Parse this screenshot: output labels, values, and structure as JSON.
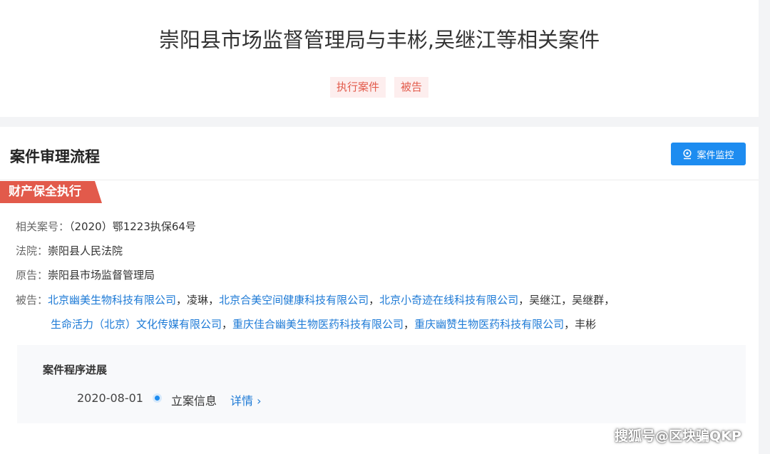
{
  "header": {
    "title": "崇阳县市场监督管理局与丰彬,吴继江等相关案件",
    "tags": [
      "执行案件",
      "被告"
    ]
  },
  "section": {
    "title": "案件审理流程",
    "monitor_label": "案件监控",
    "monitor_icon": "location-pin-icon",
    "stage": "财产保全执行"
  },
  "info": {
    "case_no_label": "相关案号：",
    "case_no": "（2020）鄂1223执保64号",
    "court_label": "法院：",
    "court": "崇阳县人民法院",
    "plaintiff_label": "原告：",
    "plaintiff": "崇阳县市场监督管理局",
    "defendant_label": "被告：",
    "defendants_line1": [
      {
        "name": "北京幽美生物科技有限公司",
        "link": true
      },
      {
        "name": "凌琳",
        "link": false
      },
      {
        "name": "北京合美空间健康科技有限公司",
        "link": true
      },
      {
        "name": "北京小奇迹在线科技有限公司",
        "link": true
      },
      {
        "name": "吴继江",
        "link": false
      },
      {
        "name": "吴继群",
        "link": false
      }
    ],
    "defendants_line2": [
      {
        "name": "生命活力（北京）文化传媒有限公司",
        "link": true
      },
      {
        "name": "重庆佳合幽美生物医药科技有限公司",
        "link": true
      },
      {
        "name": "重庆幽赞生物医药科技有限公司",
        "link": true
      },
      {
        "name": "丰彬",
        "link": false
      }
    ],
    "separator": "，"
  },
  "progress": {
    "title": "案件程序进展",
    "date": "2020-08-01",
    "event": "立案信息",
    "detail": "详情 ›"
  },
  "watermark": "搜狐号@区块骗QKP",
  "colors": {
    "accent_red": "#e25a4b",
    "link_blue": "#1d7ad6",
    "button_blue": "#1d8cf0"
  }
}
